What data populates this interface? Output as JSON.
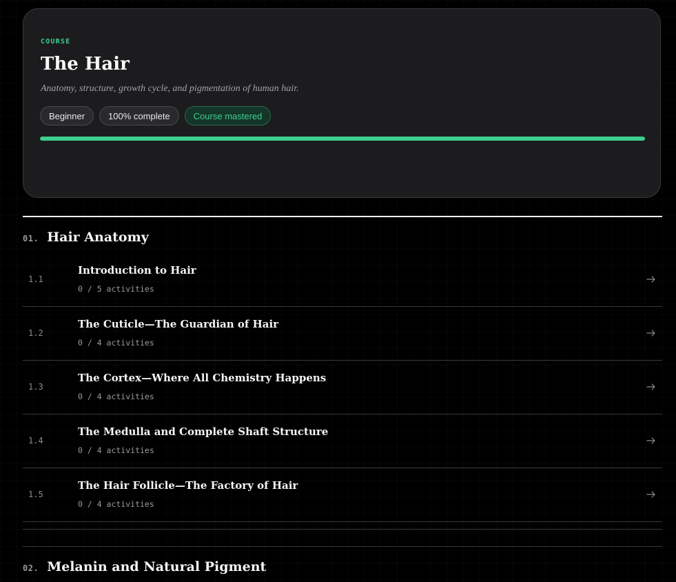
{
  "course": {
    "eyebrow": "COURSE",
    "title": "The Hair",
    "subtitle": "Anatomy, structure, growth cycle, and pigmentation of human hair.",
    "badges": {
      "level": "Beginner",
      "progress": "100% complete",
      "status": "Course mastered"
    },
    "progress_fraction": 1.0,
    "accent_color": "#3ecf8e"
  },
  "sections": [
    {
      "number": "01.",
      "title": "Hair Anatomy",
      "lessons": [
        {
          "number": "1.1",
          "title": "Introduction to Hair",
          "activities": "0 / 5 activities",
          "icon": "arrow-right-icon"
        },
        {
          "number": "1.2",
          "title": "The Cuticle—The Guardian of Hair",
          "activities": "0 / 4 activities",
          "icon": "arrow-right-icon"
        },
        {
          "number": "1.3",
          "title": "The Cortex—Where All Chemistry Happens",
          "activities": "0 / 4 activities",
          "icon": "arrow-right-icon"
        },
        {
          "number": "1.4",
          "title": "The Medulla and Complete Shaft Structure",
          "activities": "0 / 4 activities",
          "icon": "arrow-right-icon"
        },
        {
          "number": "1.5",
          "title": "The Hair Follicle—The Factory of Hair",
          "activities": "0 / 4 activities",
          "icon": "arrow-right-icon"
        }
      ]
    },
    {
      "number": "02.",
      "title": "Melanin and Natural Pigment"
    }
  ]
}
